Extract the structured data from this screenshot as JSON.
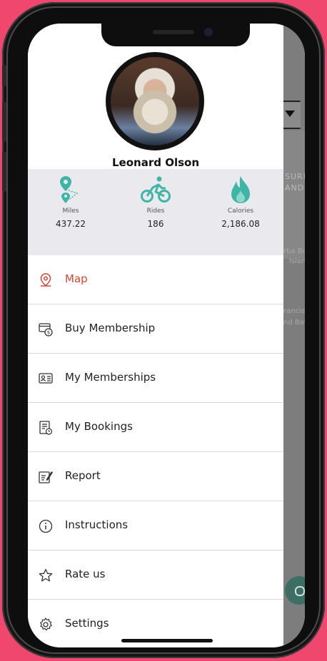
{
  "user": {
    "name": "Leonard Olson"
  },
  "stats": [
    {
      "label": "Miles",
      "value": "437.22",
      "icon": "route-pin-icon"
    },
    {
      "label": "Rides",
      "value": "186",
      "icon": "bicycle-icon"
    },
    {
      "label": "Calories",
      "value": "2,186.08",
      "icon": "flame-icon"
    }
  ],
  "menu": [
    {
      "label": "Map",
      "icon": "map-pin-icon",
      "active": true
    },
    {
      "label": "Buy Membership",
      "icon": "membership-card-icon"
    },
    {
      "label": "My Memberships",
      "icon": "id-card-icon"
    },
    {
      "label": "My Bookings",
      "icon": "bookings-doc-icon"
    },
    {
      "label": "Report",
      "icon": "report-edit-icon"
    },
    {
      "label": "Instructions",
      "icon": "info-icon"
    },
    {
      "label": "Rate us",
      "icon": "star-icon"
    },
    {
      "label": "Settings",
      "icon": "gear-icon"
    }
  ],
  "map_background": {
    "labels": [
      "SURE",
      "AND",
      "rba Bu",
      "Island",
      "rancis",
      "nd Bay"
    ]
  },
  "colors": {
    "accent": "#d64533",
    "stat_icon": "#3fb5a7",
    "background": "#f0476f",
    "stats_panel": "#eaeaee"
  }
}
